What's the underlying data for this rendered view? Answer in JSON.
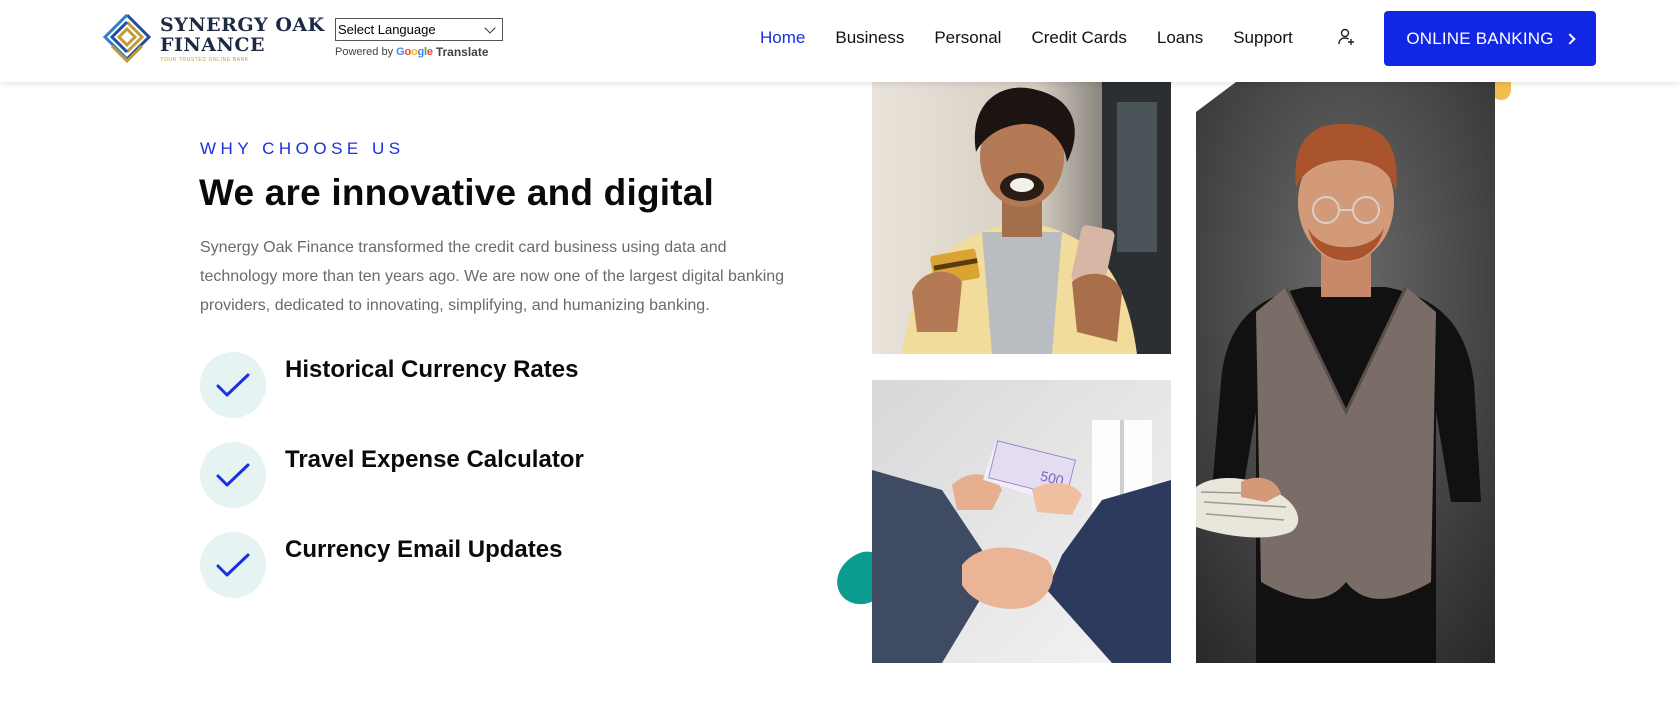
{
  "brand": {
    "name_line1": "SYNERGY OAK",
    "name_line2": "FINANCE",
    "tagline": "YOUR TRUSTED ONLINE BANK"
  },
  "language": {
    "selected": "Select Language",
    "powered_by": "Powered by",
    "google": "Google",
    "translate": "Translate"
  },
  "nav": {
    "items": [
      {
        "label": "Home",
        "active": true
      },
      {
        "label": "Business"
      },
      {
        "label": "Personal"
      },
      {
        "label": "Credit Cards"
      },
      {
        "label": "Loans"
      },
      {
        "label": "Support"
      }
    ],
    "user_icon": "user-plus-icon",
    "cta_label": "ONLINE BANKING",
    "cta_icon": "chevron-right-icon"
  },
  "section": {
    "eyebrow": "WHY CHOOSE US",
    "title": "We are innovative and digital",
    "intro": "Synergy Oak Finance transformed the credit card business using data and technology more than ten years ago. We are now one of the largest digital banking providers, dedicated to innovating, simplifying, and humanizing banking.",
    "features": [
      {
        "icon": "check-icon",
        "title": "Historical Currency Rates"
      },
      {
        "icon": "check-icon",
        "title": "Travel Expense Calculator"
      },
      {
        "icon": "check-icon",
        "title": "Currency Email Updates"
      }
    ]
  },
  "colors": {
    "accent": "#1226e6",
    "teal": "#0b9b8f",
    "yellow": "#f1be4e",
    "check_bg": "#e5f3f2"
  }
}
